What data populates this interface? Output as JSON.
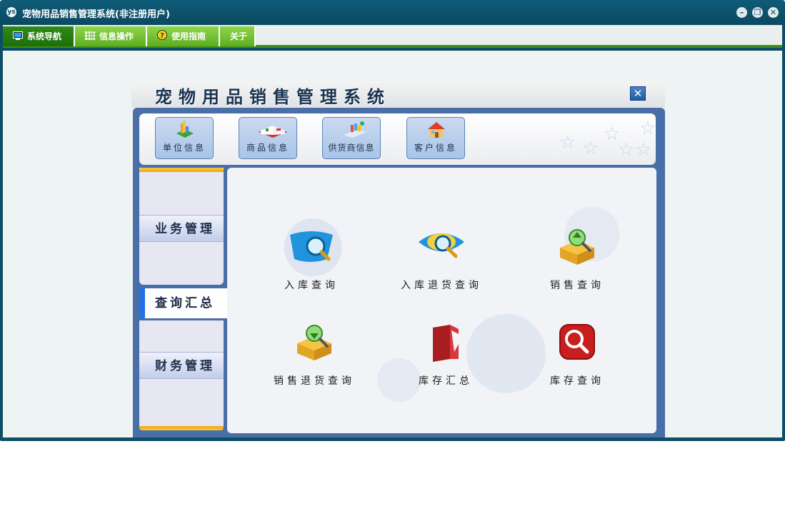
{
  "window": {
    "title": "宠物用品销售管理系统(非注册用户)",
    "app_icon_text": "ys"
  },
  "menubar": {
    "items": [
      {
        "label": "系统导航",
        "icon": "monitor-icon",
        "active": true
      },
      {
        "label": "信息操作",
        "icon": "grid-icon",
        "active": false
      },
      {
        "label": "使用指南",
        "icon": "help-icon",
        "active": false
      },
      {
        "label": "关于",
        "icon": "",
        "active": false
      }
    ]
  },
  "panel": {
    "title": "宠物用品销售管理系统",
    "close_glyph": "✕"
  },
  "toolbar": {
    "buttons": [
      {
        "label": "单位信息",
        "icon": "building-icon"
      },
      {
        "label": "商品信息",
        "icon": "book-icon"
      },
      {
        "label": "供货商信息",
        "icon": "shopping-cart-icon"
      },
      {
        "label": "客户信息",
        "icon": "house-icon"
      }
    ]
  },
  "nav": {
    "sections": [
      "业务管理",
      "查询汇总",
      "财务管理"
    ],
    "active": "查询汇总"
  },
  "functions": [
    {
      "label": "入库查询",
      "icon": "magnifier-blue-icon"
    },
    {
      "label": "入库退货查询",
      "icon": "magnifier-eye-icon"
    },
    {
      "label": "销售查询",
      "icon": "box-search-up-icon"
    },
    {
      "label": "销售退货查询",
      "icon": "box-search-down-icon"
    },
    {
      "label": "库存汇总",
      "icon": "red-document-icon"
    },
    {
      "label": "库存查询",
      "icon": "red-search-icon"
    }
  ],
  "colors": {
    "title_bar": "#0b4961",
    "menu_green": "#5ead21",
    "menu_active": "#1d6e0a",
    "nav_accent": "#2173e2",
    "frame_blue": "#4a6fa8"
  }
}
